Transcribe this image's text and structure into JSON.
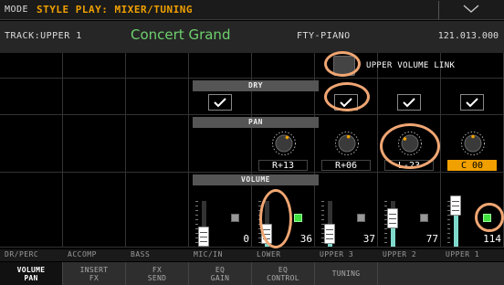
{
  "mode": {
    "label": "MODE",
    "value": "STYLE PLAY: MIXER/TUNING"
  },
  "track": {
    "label": "TRACK:UPPER 1",
    "sound": "Concert Grand",
    "category": "FTY-PIANO",
    "number": "121.013.000"
  },
  "upper_volume_link": {
    "label": "UPPER VOLUME LINK",
    "checked": false
  },
  "sections": {
    "dry": "DRY",
    "pan": "PAN",
    "volume": "VOLUME"
  },
  "channels": [
    {
      "name": "DR/PERC"
    },
    {
      "name": "ACCOMP"
    },
    {
      "name": "BASS"
    },
    {
      "name": "MIC/IN",
      "dry": true,
      "volume": "0",
      "level": 0.0,
      "mute": false
    },
    {
      "name": "LOWER",
      "pan": "R+13",
      "volume": "36",
      "level": 0.28,
      "mute": true
    },
    {
      "name": "UPPER 3",
      "dry": true,
      "pan": "R+06",
      "volume": "37",
      "level": 0.29,
      "mute": false
    },
    {
      "name": "UPPER 2",
      "dry": true,
      "pan": "L-23",
      "volume": "77",
      "level": 0.61,
      "mute": false
    },
    {
      "name": "UPPER 1",
      "dry": true,
      "pan": "C 00",
      "volume": "114",
      "level": 0.9,
      "mute": true
    }
  ],
  "tabs": [
    {
      "line1": "VOLUME",
      "line2": "PAN"
    },
    {
      "line1": "INSERT",
      "line2": "FX"
    },
    {
      "line1": "FX",
      "line2": "SEND"
    },
    {
      "line1": "EQ",
      "line2": "GAIN"
    },
    {
      "line1": "EQ",
      "line2": "CONTROL"
    },
    {
      "line1": "TUNING",
      "line2": ""
    }
  ],
  "colors": {
    "accent": "#f0a000",
    "track_name": "#6ed06e",
    "mute_on": "#3fe03f",
    "fader_fill": "#7fd9cb",
    "highlight": "#f0a673"
  }
}
